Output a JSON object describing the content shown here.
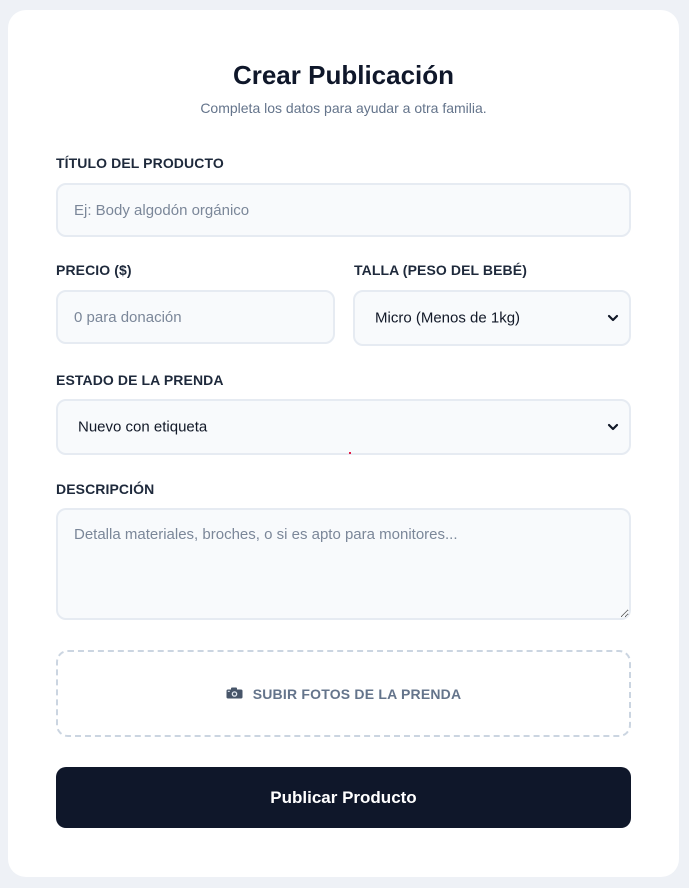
{
  "form": {
    "title": "Crear Publicación",
    "subtitle": "Completa los datos para ayudar a otra familia.",
    "product_title": {
      "label": "TÍTULO DEL PRODUCTO",
      "placeholder": "Ej: Body algodón orgánico",
      "value": ""
    },
    "price": {
      "label": "PRECIO ($)",
      "placeholder": "0 para donación",
      "value": ""
    },
    "size": {
      "label": "TALLA (PESO DEL BEBÉ)",
      "selected": "Micro (Menos de 1kg)"
    },
    "condition": {
      "label": "ESTADO DE LA PRENDA",
      "selected": "Nuevo con etiqueta"
    },
    "description": {
      "label": "DESCRIPCIÓN",
      "placeholder": "Detalla materiales, broches, o si es apto para monitores...",
      "value": ""
    },
    "upload": {
      "label": "SUBIR FOTOS DE LA PRENDA",
      "icon": "camera-icon"
    },
    "submit_label": "Publicar Producto"
  },
  "colors": {
    "background": "#eef1f6",
    "card": "#ffffff",
    "primary_button": "#0f172a",
    "field_border": "#e6ebf2",
    "field_bg": "#f8fafc",
    "muted_text": "#64748b"
  }
}
